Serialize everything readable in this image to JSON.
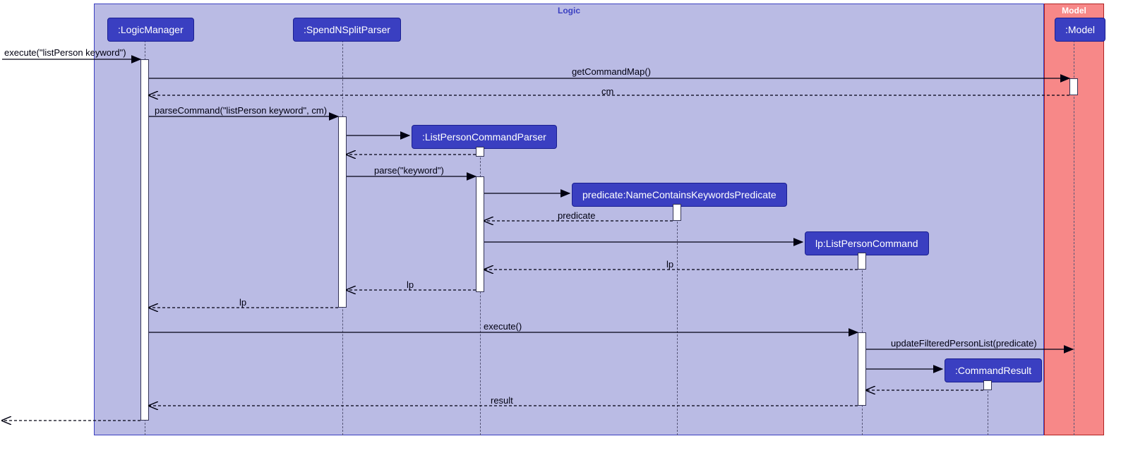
{
  "regions": {
    "logic": {
      "title": "Logic"
    },
    "model": {
      "title": "Model"
    }
  },
  "participants": {
    "logicManager": ":LogicManager",
    "spendNSplitParser": ":SpendNSplitParser",
    "listPersonCommandParser": ":ListPersonCommandParser",
    "predicate": "predicate:NameContainsKeywordsPredicate",
    "listPersonCommand": "lp:ListPersonCommand",
    "commandResult": ":CommandResult",
    "model": ":Model"
  },
  "messages": {
    "m1": "execute(\"listPerson keyword\")",
    "m2": "getCommandMap()",
    "m3": "cm",
    "m4": "parseCommand(\"listPerson keyword\", cm)",
    "m5": "",
    "m6": "parse(\"keyword\")",
    "m7": "predicate",
    "m8": "lp",
    "m9": "lp",
    "m10": "lp",
    "m11": "execute()",
    "m12": "updateFilteredPersonList(predicate)",
    "m13": "result"
  },
  "chart_data": {
    "type": "sequence-diagram",
    "title": "",
    "frames": [
      {
        "name": "Logic",
        "participants": [
          "LogicManager",
          "SpendNSplitParser",
          "ListPersonCommandParser",
          "NameContainsKeywordsPredicate",
          "ListPersonCommand",
          "CommandResult"
        ]
      },
      {
        "name": "Model",
        "participants": [
          "Model"
        ]
      }
    ],
    "participants": [
      {
        "id": "actor",
        "label": "",
        "external": true
      },
      {
        "id": "LogicManager",
        "label": ":LogicManager"
      },
      {
        "id": "SpendNSplitParser",
        "label": ":SpendNSplitParser"
      },
      {
        "id": "ListPersonCommandParser",
        "label": ":ListPersonCommandParser",
        "created_by_message": 5
      },
      {
        "id": "NameContainsKeywordsPredicate",
        "label": "predicate:NameContainsKeywordsPredicate",
        "created_by_message": 7
      },
      {
        "id": "ListPersonCommand",
        "label": "lp:ListPersonCommand",
        "created_by_message": 9
      },
      {
        "id": "CommandResult",
        "label": ":CommandResult",
        "created_by_message": 14
      },
      {
        "id": "Model",
        "label": ":Model"
      }
    ],
    "messages": [
      {
        "n": 1,
        "from": "actor",
        "to": "LogicManager",
        "kind": "call",
        "label": "execute(\"listPerson keyword\")"
      },
      {
        "n": 2,
        "from": "LogicManager",
        "to": "Model",
        "kind": "call",
        "label": "getCommandMap()"
      },
      {
        "n": 3,
        "from": "Model",
        "to": "LogicManager",
        "kind": "return",
        "label": "cm"
      },
      {
        "n": 4,
        "from": "LogicManager",
        "to": "SpendNSplitParser",
        "kind": "call",
        "label": "parseCommand(\"listPerson keyword\", cm)"
      },
      {
        "n": 5,
        "from": "SpendNSplitParser",
        "to": "ListPersonCommandParser",
        "kind": "create",
        "label": ""
      },
      {
        "n": 6,
        "from": "SpendNSplitParser",
        "to": "ListPersonCommandParser",
        "kind": "call",
        "label": "parse(\"keyword\")"
      },
      {
        "n": 7,
        "from": "ListPersonCommandParser",
        "to": "NameContainsKeywordsPredicate",
        "kind": "create",
        "label": ""
      },
      {
        "n": 8,
        "from": "NameContainsKeywordsPredicate",
        "to": "ListPersonCommandParser",
        "kind": "return",
        "label": "predicate"
      },
      {
        "n": 9,
        "from": "ListPersonCommandParser",
        "to": "ListPersonCommand",
        "kind": "create",
        "label": ""
      },
      {
        "n": 10,
        "from": "ListPersonCommand",
        "to": "ListPersonCommandParser",
        "kind": "return",
        "label": "lp"
      },
      {
        "n": 11,
        "from": "ListPersonCommandParser",
        "to": "SpendNSplitParser",
        "kind": "return",
        "label": "lp"
      },
      {
        "n": 12,
        "from": "SpendNSplitParser",
        "to": "LogicManager",
        "kind": "return",
        "label": "lp"
      },
      {
        "n": 13,
        "from": "LogicManager",
        "to": "ListPersonCommand",
        "kind": "call",
        "label": "execute()"
      },
      {
        "n": 14,
        "from": "ListPersonCommand",
        "to": "Model",
        "kind": "call",
        "label": "updateFilteredPersonList(predicate)"
      },
      {
        "n": 15,
        "from": "ListPersonCommand",
        "to": "CommandResult",
        "kind": "create",
        "label": ""
      },
      {
        "n": 16,
        "from": "CommandResult",
        "to": "ListPersonCommand",
        "kind": "return",
        "label": ""
      },
      {
        "n": 17,
        "from": "ListPersonCommand",
        "to": "LogicManager",
        "kind": "return",
        "label": "result"
      },
      {
        "n": 18,
        "from": "LogicManager",
        "to": "actor",
        "kind": "return",
        "label": ""
      }
    ]
  }
}
